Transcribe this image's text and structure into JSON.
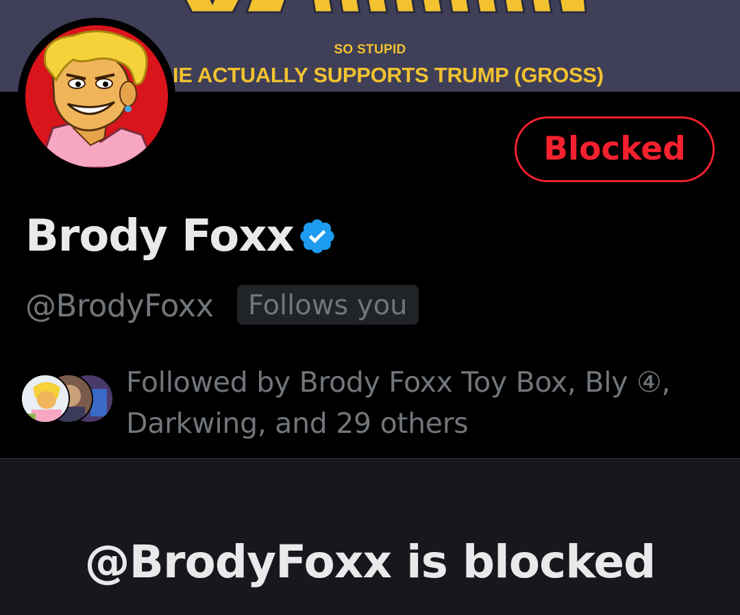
{
  "banner": {
    "logo_icon": "banner-logo-letters",
    "small_text": "SO STUPID",
    "big_text": "IE ACTUALLY SUPPORTS TRUMP (GROSS)"
  },
  "profile": {
    "avatar_icon": "cartoon-avatar",
    "display_name": "Brody Foxx",
    "verified_icon": "verified-badge-icon",
    "handle": "@BrodyFoxx",
    "follows_you": "Follows you",
    "action_button": "Blocked",
    "followed_by": "Followed by Brody Foxx Toy Box, Bly ④, Darkwing, and 29 others"
  },
  "blocked_notice": {
    "title": "@BrodyFoxx is blocked"
  },
  "colors": {
    "background": "#000000",
    "banner": "#3f3f58",
    "banner_text": "#f2c230",
    "blocked_red": "#f4212e",
    "verified_blue": "#1d9bf0",
    "secondary_text": "#71767b",
    "primary_text": "#e7e9ea",
    "panel": "#16181c"
  }
}
